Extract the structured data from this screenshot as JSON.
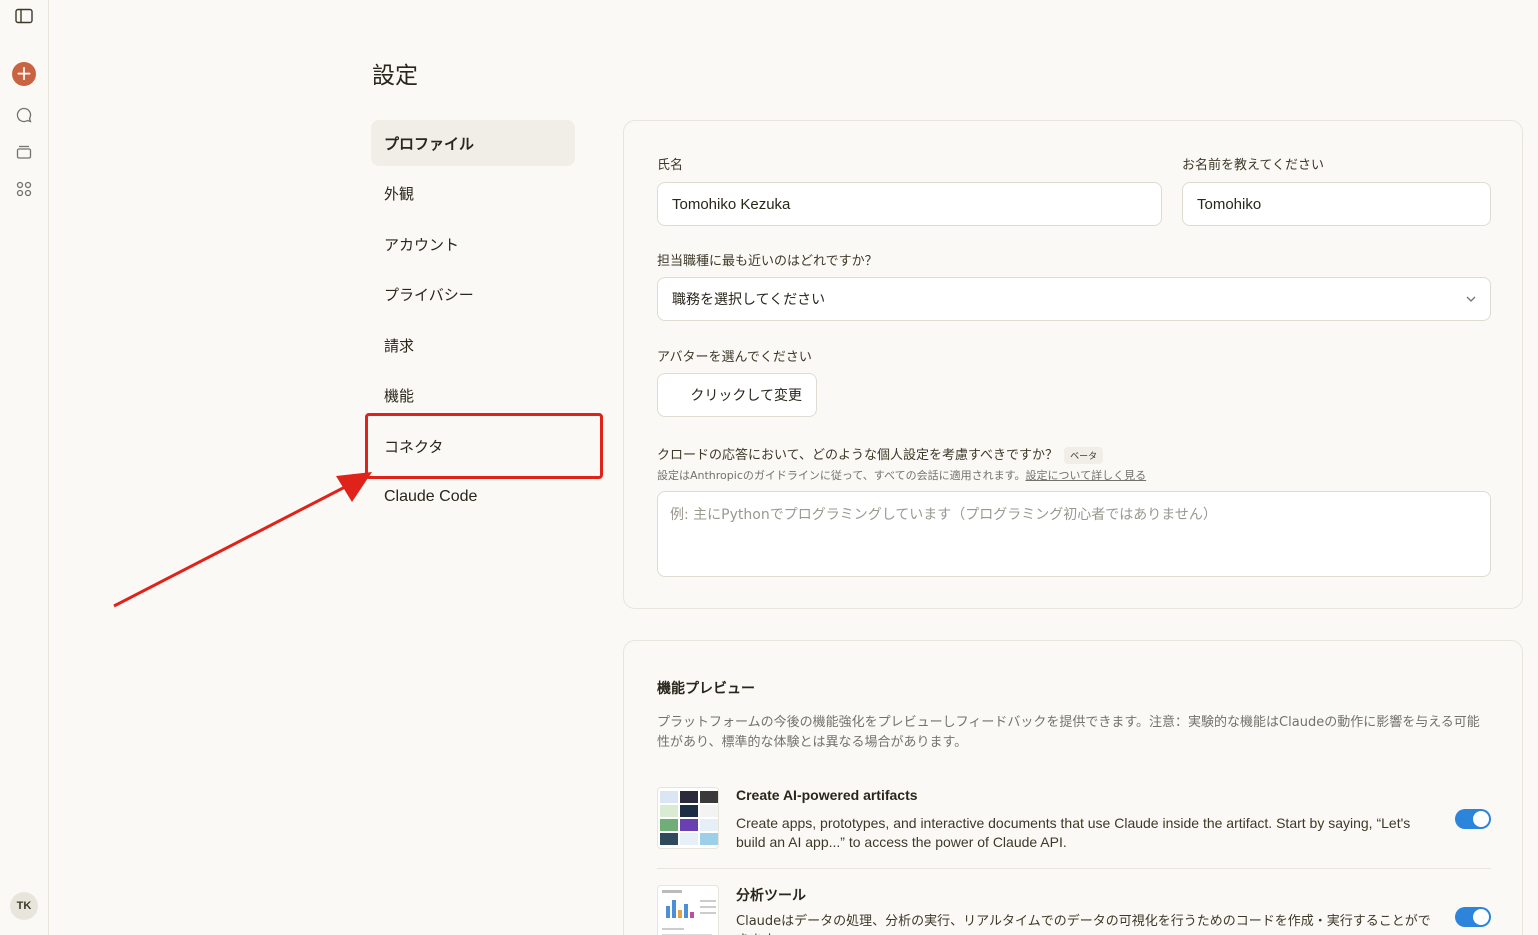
{
  "rail": {
    "avatar_initials": "TK",
    "accent_color": "#c96442"
  },
  "page": {
    "title": "設定"
  },
  "nav": {
    "items": [
      {
        "label": "プロファイル"
      },
      {
        "label": "外観"
      },
      {
        "label": "アカウント"
      },
      {
        "label": "プライバシー"
      },
      {
        "label": "請求"
      },
      {
        "label": "機能"
      },
      {
        "label": "コネクタ"
      },
      {
        "label": "Claude Code"
      }
    ],
    "highlight_color": "#e0231a"
  },
  "profile": {
    "full_name_label": "氏名",
    "full_name_value": "Tomohiko Kezuka",
    "nickname_label": "お名前を教えてください",
    "nickname_value": "Tomohiko",
    "role_label": "担当職種に最も近いのはどれですか？",
    "role_value": "職務を選択してください",
    "avatar_label": "アバターを選んでください",
    "avatar_button": "クリックして変更",
    "prefs_label": "クロードの応答において、どのような個人設定を考慮すべきですか？",
    "prefs_badge": "ベータ",
    "prefs_hint": "設定はAnthropicのガイドラインに従って、すべての会話に適用されます。",
    "prefs_hint_link": "設定について詳しく見る",
    "prefs_placeholder": "例: 主にPythonでプログラミングしています（プログラミング初心者ではありません）"
  },
  "preview": {
    "title": "機能プレビュー",
    "description": "プラットフォームの今後の機能強化をプレビューしフィードバックを提供できます。注意：実験的な機能はClaudeの動作に影響を与える可能性があり、標準的な体験とは異なる場合があります。",
    "features": [
      {
        "title": "Create AI-powered artifacts",
        "description": "Create apps, prototypes, and interactive documents that use Claude inside the artifact. Start by saying, “Let's build an AI app...” to access the power of Claude API.",
        "enabled": true
      },
      {
        "title": "分析ツール",
        "description": "Claudeはデータの処理、分析の実行、リアルタイムでのデータの可視化を行うためのコードを作成・実行することができます。",
        "enabled": true
      }
    ],
    "toggle_color": "#2c84db"
  }
}
